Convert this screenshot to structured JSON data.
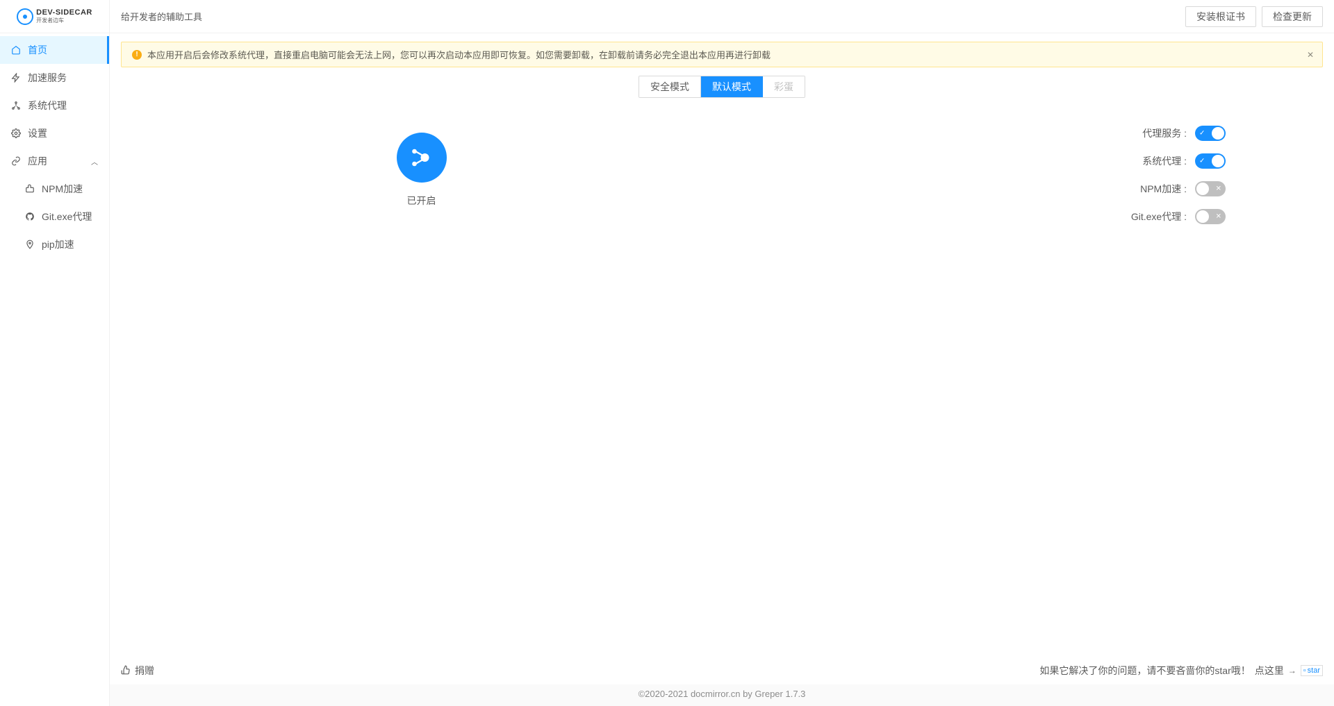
{
  "logo": {
    "name": "DEV-SIDECAR",
    "sub": "开发者边车"
  },
  "header": {
    "title": "给开发者的辅助工具",
    "install_cert": "安装根证书",
    "check_update": "检查更新"
  },
  "sidebar": {
    "items": [
      {
        "label": "首页",
        "icon": "home"
      },
      {
        "label": "加速服务",
        "icon": "bolt"
      },
      {
        "label": "系统代理",
        "icon": "network"
      },
      {
        "label": "设置",
        "icon": "gear"
      },
      {
        "label": "应用",
        "icon": "link"
      }
    ],
    "submenu": [
      {
        "label": "NPM加速",
        "icon": "thumb"
      },
      {
        "label": "Git.exe代理",
        "icon": "github"
      },
      {
        "label": "pip加速",
        "icon": "pin"
      }
    ]
  },
  "alert": {
    "text": "本应用开启后会修改系统代理，直接重启电脑可能会无法上网，您可以再次启动本应用即可恢复。如您需要卸载，在卸载前请务必完全退出本应用再进行卸载"
  },
  "modes": {
    "safe": "安全模式",
    "default": "默认模式",
    "egg": "彩蛋"
  },
  "status": {
    "text": "已开启"
  },
  "switches": [
    {
      "label": "代理服务",
      "on": true,
      "inner_on": "✓",
      "inner_off": "✕"
    },
    {
      "label": "系统代理",
      "on": true,
      "inner_on": "✓",
      "inner_off": "✕"
    },
    {
      "label": "NPM加速",
      "on": false,
      "inner_on": "✓",
      "inner_off": "✕"
    },
    {
      "label": "Git.exe代理",
      "on": false,
      "inner_on": "✓",
      "inner_off": "✕"
    }
  ],
  "footer": {
    "donate": "捐赠",
    "msg": "如果它解决了你的问题，请不要吝啬你的star哦！",
    "link": "点这里",
    "star": "star"
  },
  "copyright": "©2020-2021 docmirror.cn by Greper 1.7.3"
}
